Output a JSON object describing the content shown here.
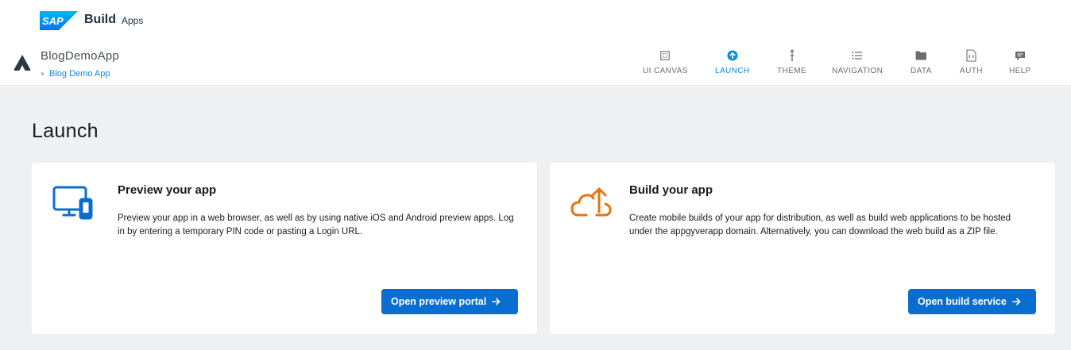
{
  "shell": {
    "logo_text": "SAP",
    "product_name": "Build",
    "product_sub": "Apps"
  },
  "app": {
    "name": "BlogDemoApp",
    "breadcrumb": "Blog Demo App"
  },
  "nav": {
    "items": [
      {
        "label": "UI CANVAS",
        "icon": "ui-canvas-icon",
        "active": false
      },
      {
        "label": "LAUNCH",
        "icon": "launch-icon",
        "active": true
      },
      {
        "label": "THEME",
        "icon": "theme-icon",
        "active": false
      },
      {
        "label": "NAVIGATION",
        "icon": "navigation-icon",
        "active": false
      },
      {
        "label": "DATA",
        "icon": "folder-icon",
        "active": false
      },
      {
        "label": "AUTH",
        "icon": "auth-icon",
        "active": false
      },
      {
        "label": "HELP",
        "icon": "chat-icon",
        "active": false
      }
    ]
  },
  "page": {
    "title": "Launch"
  },
  "cards": {
    "preview": {
      "title": "Preview your app",
      "description": "Preview your app in a web browser, as well as by using native iOS and Android preview apps. Log in by entering a temporary PIN code or pasting a Login URL.",
      "button_label": "Open preview portal",
      "icon": "devices-icon"
    },
    "build": {
      "title": "Build your app",
      "description": "Create mobile builds of your app for distribution, as well as build web applications to be hosted under the appgyverapp domain. Alternatively, you can download the web build as a ZIP file.",
      "button_label": "Open build service",
      "icon": "cloud-upload-icon"
    }
  },
  "colors": {
    "accent": "#0a6ed1",
    "active_nav": "#0a8dd8",
    "build_icon": "#e9730c",
    "preview_icon": "#0a6ed1",
    "background": "#eff0f2"
  }
}
